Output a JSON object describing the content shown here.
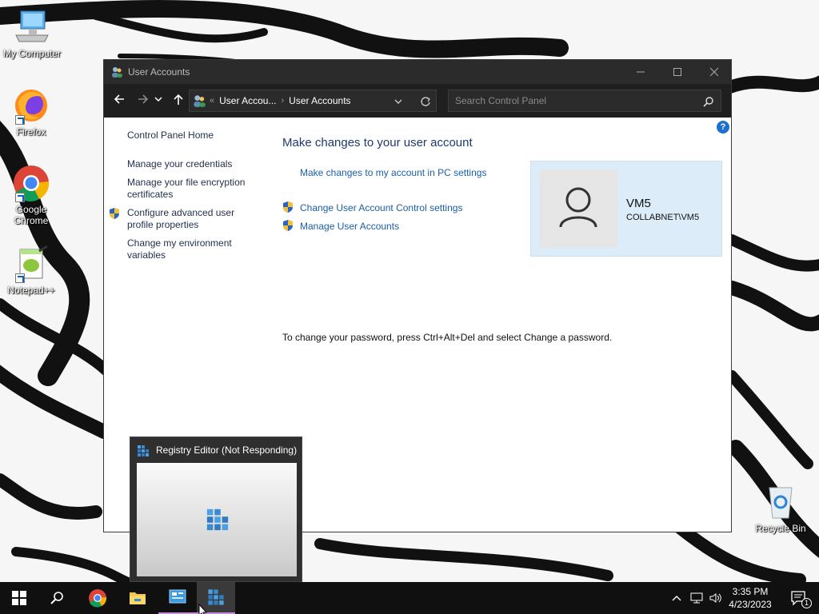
{
  "desktop": {
    "icons": [
      {
        "label": "My Computer"
      },
      {
        "label": "Firefox"
      },
      {
        "label": "Google Chrome"
      },
      {
        "label": "Notepad++"
      },
      {
        "label": "Recycle Bin"
      }
    ]
  },
  "window": {
    "title": "User Accounts",
    "address": {
      "crumb1": "User Accou...",
      "crumb2": "User Accounts"
    },
    "search_placeholder": "Search Control Panel",
    "help_label": "?"
  },
  "sidebar": {
    "home": "Control Panel Home",
    "items": [
      {
        "label": "Manage your credentials"
      },
      {
        "label": "Manage your file encryption certificates"
      },
      {
        "label": "Configure advanced user profile properties"
      },
      {
        "label": "Change my environment variables"
      }
    ]
  },
  "main": {
    "title": "Make changes to your user account",
    "pc_settings_link": "Make changes to my account in PC settings",
    "uac_link": "Change User Account Control settings",
    "manage_link": "Manage User Accounts",
    "password_note": "To change your password, press Ctrl+Alt+Del and select Change a password."
  },
  "user": {
    "name": "VM5",
    "domain": "COLLABNET\\VM5"
  },
  "thumbnail": {
    "title": "Registry Editor (Not Responding)"
  },
  "taskbar": {
    "time": "3:35 PM",
    "date": "4/23/2023",
    "notification_count": "1",
    "active_color": "#c68cd9"
  }
}
